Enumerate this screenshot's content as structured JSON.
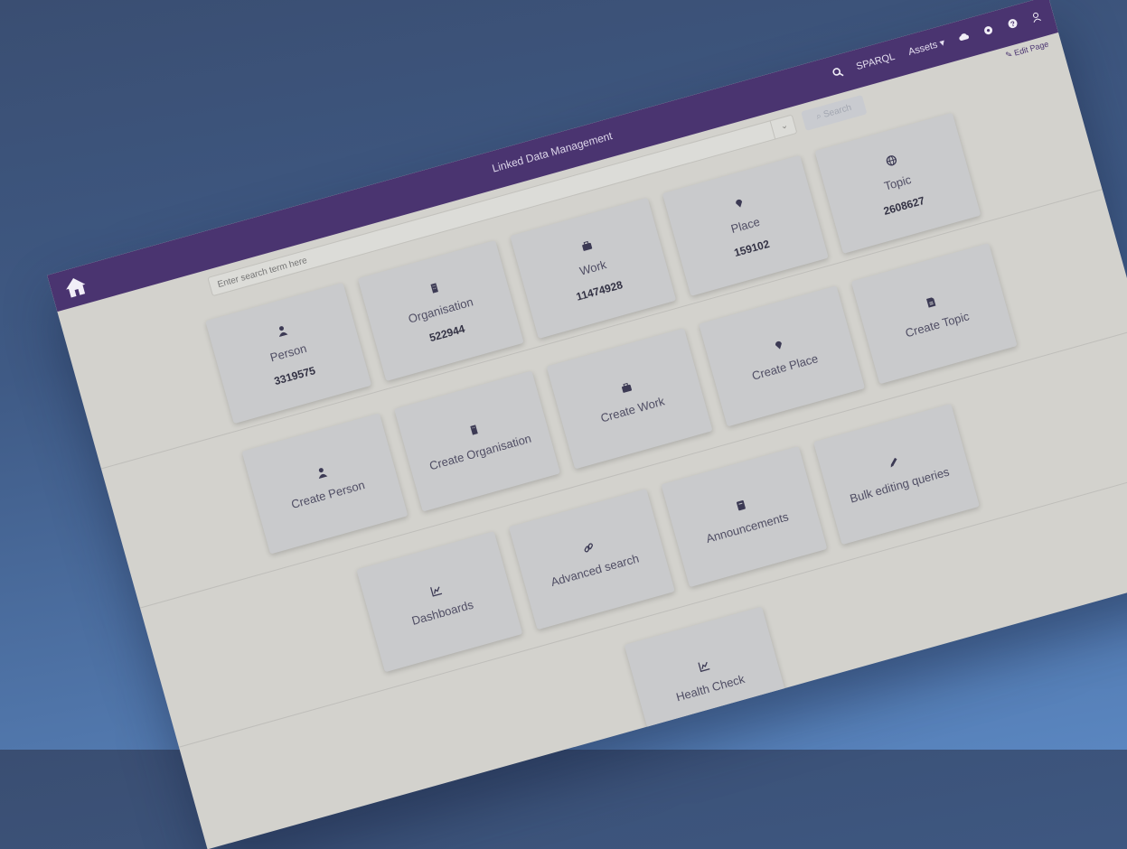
{
  "header": {
    "title": "Linked Data Management",
    "nav": {
      "sparql": "SPARQL",
      "assets": "Assets"
    },
    "edit_page": "Edit Page"
  },
  "search": {
    "placeholder": "Enter search term here",
    "button_label": "Search"
  },
  "entities": [
    {
      "label": "Person",
      "count": "3319575",
      "icon": "person-icon"
    },
    {
      "label": "Organisation",
      "count": "522944",
      "icon": "building-icon"
    },
    {
      "label": "Work",
      "count": "11474928",
      "icon": "briefcase-icon"
    },
    {
      "label": "Place",
      "count": "159102",
      "icon": "map-pin-icon"
    },
    {
      "label": "Topic",
      "count": "2608627",
      "icon": "globe-icon"
    }
  ],
  "create_actions": [
    {
      "label": "Create Person",
      "icon": "person-icon"
    },
    {
      "label": "Create Organisation",
      "icon": "building-icon"
    },
    {
      "label": "Create Work",
      "icon": "briefcase-icon"
    },
    {
      "label": "Create Place",
      "icon": "map-pin-icon"
    },
    {
      "label": "Create Topic",
      "icon": "document-icon"
    }
  ],
  "tools": [
    {
      "label": "Dashboards",
      "icon": "chart-icon"
    },
    {
      "label": "Advanced search",
      "icon": "link-icon"
    },
    {
      "label": "Announcements",
      "icon": "book-icon"
    },
    {
      "label": "Bulk editing queries",
      "icon": "pencil-icon"
    },
    {
      "label": "Health Check",
      "icon": "chart-icon"
    }
  ],
  "colors": {
    "header": "#4a3470",
    "page": "#d3d2cd",
    "card": "#c9cacc"
  }
}
